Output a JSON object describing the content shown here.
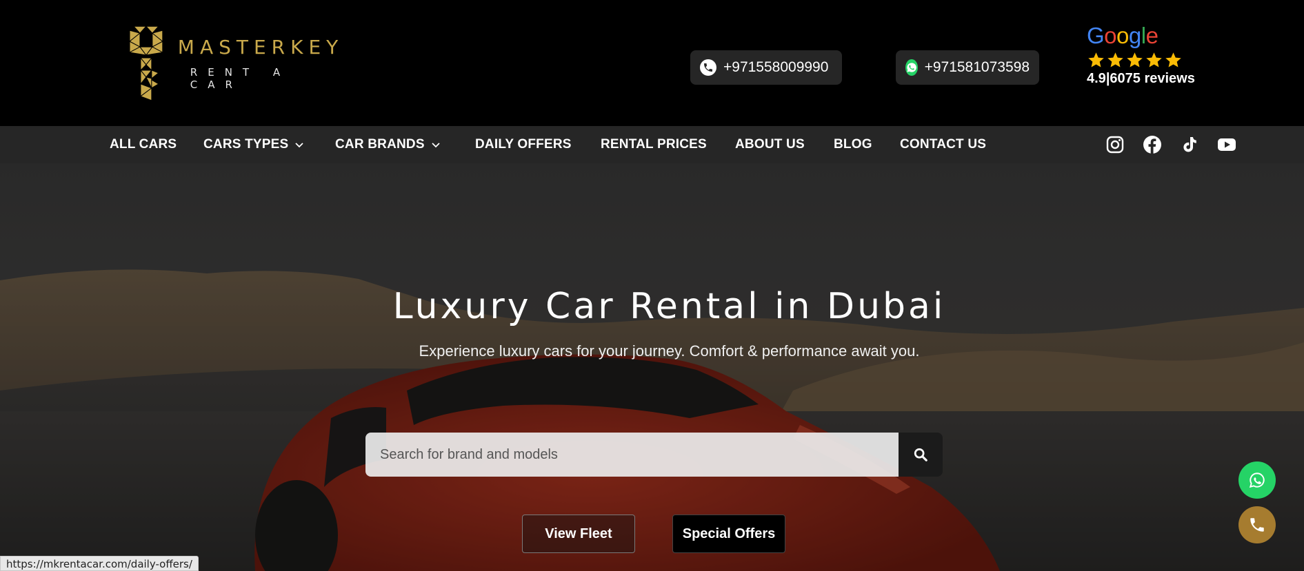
{
  "brand": {
    "name": "MASTERKEY",
    "tagline": "RENT A CAR",
    "gold": "#c9a94b"
  },
  "contacts": {
    "phone": "+971558009990",
    "whatsapp": "+971581073598"
  },
  "google": {
    "word": [
      "G",
      "o",
      "o",
      "g",
      "l",
      "e"
    ],
    "stars": 5,
    "rating": "4.9",
    "separator": "|",
    "reviews": "6075 reviews"
  },
  "nav": {
    "items": [
      {
        "label": "ALL CARS",
        "dropdown": false
      },
      {
        "label": "CARS TYPES",
        "dropdown": true
      },
      {
        "label": "CAR BRANDS",
        "dropdown": true
      },
      {
        "label": "DAILY OFFERS",
        "dropdown": false
      },
      {
        "label": "RENTAL PRICES",
        "dropdown": false
      },
      {
        "label": "ABOUT US",
        "dropdown": false
      },
      {
        "label": "BLOG",
        "dropdown": false
      },
      {
        "label": "CONTACT US",
        "dropdown": false
      }
    ],
    "social": [
      "instagram-icon",
      "facebook-icon",
      "tiktok-icon",
      "youtube-icon"
    ]
  },
  "hero": {
    "title": "Luxury Car Rental in Dubai",
    "subtitle": "Experience luxury cars for your journey. Comfort & performance await you.",
    "search_placeholder": "Search for brand and models",
    "view_fleet": "View Fleet",
    "special_offers": "Special Offers"
  },
  "floating": {
    "whatsapp_color": "#25d366",
    "call_color": "#a67c2f"
  },
  "status_bar": {
    "url": "https://mkrentacar.com/daily-offers/"
  }
}
